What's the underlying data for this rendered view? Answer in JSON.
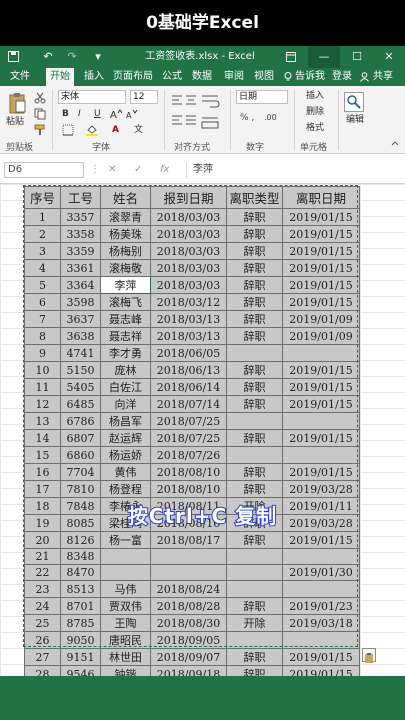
{
  "banner": "0基础学Excel",
  "window": {
    "title": "工资签收表.xlsx - Excel",
    "undo": "↶",
    "redo": "↷",
    "minimize": "—",
    "maximize": "☐",
    "close": "✕"
  },
  "menu": {
    "tabs": [
      "文件",
      "开始",
      "插入",
      "页面布局",
      "公式",
      "数据",
      "审阅",
      "视图"
    ],
    "active": "开始",
    "tell_me": "告诉我",
    "login": "登录",
    "share": "共享"
  },
  "ribbon": {
    "paste": "粘贴",
    "font_name": "宋体",
    "font_size": "12",
    "number_format": "日期",
    "insert": "插入",
    "delete": "删除",
    "format": "格式",
    "edit": "编辑",
    "groups": [
      "剪贴板",
      "字体",
      "对齐方式",
      "数字",
      "单元格"
    ],
    "bold": "B",
    "italic": "I",
    "underline": "U",
    "font_color_letter": "A",
    "wen": "文"
  },
  "formula_bar": {
    "name_box": "D6",
    "cancel": "✕",
    "enter": "✓",
    "fx": "fx",
    "value": "李萍"
  },
  "table": {
    "headers": [
      "序号",
      "工号",
      "姓名",
      "报到日期",
      "离职类型",
      "离职日期"
    ],
    "rows": [
      [
        "1",
        "3357",
        "滚翠青",
        "2018/03/03",
        "辞职",
        "2019/01/15"
      ],
      [
        "2",
        "3358",
        "杨美珠",
        "2018/03/03",
        "辞职",
        "2019/01/15"
      ],
      [
        "3",
        "3359",
        "杨梅别",
        "2018/03/03",
        "辞职",
        "2019/01/15"
      ],
      [
        "4",
        "3361",
        "滚梅敬",
        "2018/03/03",
        "辞职",
        "2019/01/15"
      ],
      [
        "5",
        "3364",
        "李萍",
        "2018/03/03",
        "辞职",
        "2019/01/15"
      ],
      [
        "6",
        "3598",
        "滚梅飞",
        "2018/03/12",
        "辞职",
        "2019/01/15"
      ],
      [
        "7",
        "3637",
        "聂志峰",
        "2018/03/13",
        "辞职",
        "2019/01/09"
      ],
      [
        "8",
        "3638",
        "聂志祥",
        "2018/03/13",
        "辞职",
        "2019/01/09"
      ],
      [
        "9",
        "4741",
        "李才勇",
        "2018/06/05",
        "",
        ""
      ],
      [
        "10",
        "5150",
        "庞林",
        "2018/06/13",
        "辞职",
        "2019/01/15"
      ],
      [
        "11",
        "5405",
        "白佐江",
        "2018/06/14",
        "辞职",
        "2019/01/15"
      ],
      [
        "12",
        "6485",
        "向洋",
        "2018/07/14",
        "辞职",
        "2019/01/15"
      ],
      [
        "13",
        "6786",
        "杨昌军",
        "2018/07/25",
        "",
        ""
      ],
      [
        "14",
        "6807",
        "赵运辉",
        "2018/07/25",
        "辞职",
        "2019/01/15"
      ],
      [
        "15",
        "6860",
        "杨运娇",
        "2018/07/26",
        "",
        ""
      ],
      [
        "16",
        "7704",
        "黄伟",
        "2018/08/10",
        "辞职",
        "2019/01/15"
      ],
      [
        "17",
        "7810",
        "杨登程",
        "2018/08/10",
        "辞职",
        "2019/03/28"
      ],
      [
        "18",
        "7848",
        "李椿永",
        "2018/08/11",
        "开除",
        "2019/01/11"
      ],
      [
        "19",
        "8085",
        "梁桂鸿",
        "2018/08/16",
        "辞职",
        "2019/03/28"
      ],
      [
        "20",
        "8126",
        "杨一富",
        "2018/08/17",
        "辞职",
        "2019/01/15"
      ],
      [
        "21",
        "8348",
        "",
        "",
        "",
        ""
      ],
      [
        "22",
        "8470",
        "",
        "",
        "",
        "2019/01/30"
      ],
      [
        "23",
        "8513",
        "马伟",
        "2018/08/24",
        "",
        ""
      ],
      [
        "24",
        "8701",
        "贾双伟",
        "2018/08/28",
        "辞职",
        "2019/01/23"
      ],
      [
        "25",
        "8785",
        "王陶",
        "2018/08/30",
        "开除",
        "2019/03/18"
      ],
      [
        "26",
        "9050",
        "唐昭民",
        "2018/09/05",
        "",
        ""
      ],
      [
        "27",
        "9151",
        "林世田",
        "2018/09/07",
        "辞职",
        "2019/01/15"
      ],
      [
        "28",
        "9546",
        "钟锴",
        "2018/09/18",
        "辞职",
        "2019/01/15"
      ],
      [
        "29",
        "9610",
        "宋海先",
        "2018/09/19",
        "辞职",
        "2018/01/23"
      ]
    ],
    "active_row": 4,
    "active_col": 2
  },
  "caption": "按Ctrl+C 复制",
  "colors": {
    "excel_green": "#217346",
    "caption_stroke": "#2b3fd1"
  }
}
